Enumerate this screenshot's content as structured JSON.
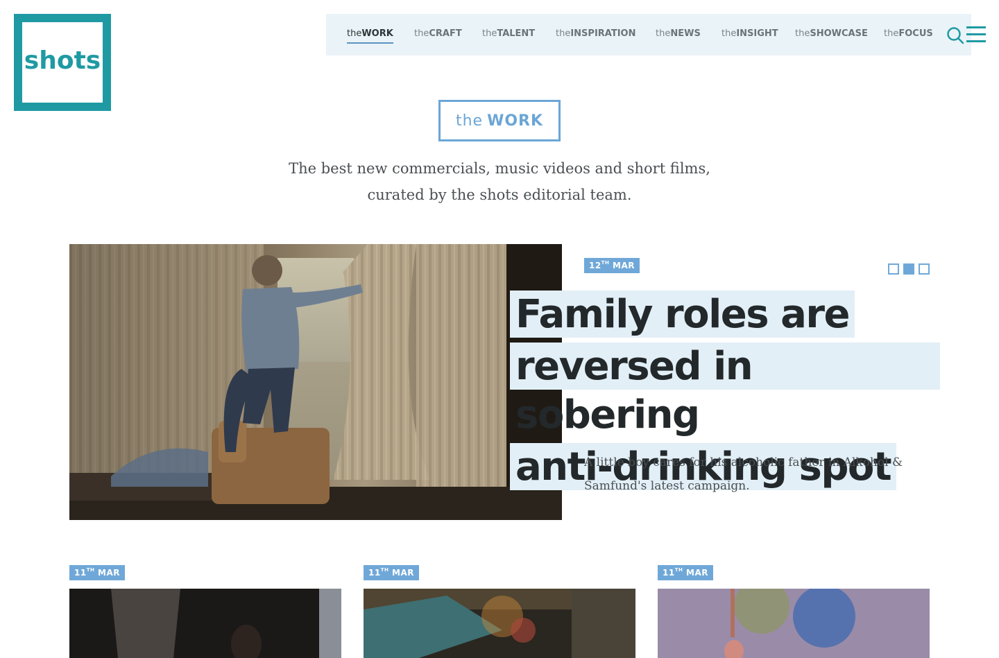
{
  "logo": {
    "text": "shots"
  },
  "nav": {
    "items": [
      {
        "pre": "the",
        "main": "WORK",
        "active": true
      },
      {
        "pre": "the",
        "main": "CRAFT"
      },
      {
        "pre": "the",
        "main": "TALENT"
      },
      {
        "pre": "the",
        "main": "INSPIRATION"
      },
      {
        "pre": "the",
        "main": "NEWS"
      },
      {
        "pre": "the",
        "main": "INSIGHT"
      },
      {
        "pre": "the",
        "main": "SHOWCASE"
      },
      {
        "pre": "the",
        "main": "FOCUS"
      }
    ],
    "icons": [
      "search-icon",
      "menu-icon"
    ]
  },
  "section": {
    "pre": "the",
    "main": "WORK",
    "intro_line1": "The best new commercials, music videos and short films,",
    "intro_line2": "curated by the shots editorial team."
  },
  "hero": {
    "date_day": "12",
    "date_suffix": "TH",
    "date_month": "MAR",
    "headline_lines": [
      "Family roles are",
      "reversed in sobering",
      "anti-drinking spot"
    ],
    "description": "A little boy cares for his alcoholic father in Alkohol & Samfund's latest campaign.",
    "carousel": {
      "count": 3,
      "active_index": 1
    }
  },
  "cards": [
    {
      "date_day": "11",
      "date_suffix": "TH",
      "date_month": "MAR"
    },
    {
      "date_day": "11",
      "date_suffix": "TH",
      "date_month": "MAR"
    },
    {
      "date_day": "11",
      "date_suffix": "TH",
      "date_month": "MAR"
    }
  ],
  "colors": {
    "brand_teal": "#1f9aa3",
    "accent_blue": "#6fa8d8",
    "nav_bg": "#eaf3f7",
    "headline_highlight": "#e2eff6"
  }
}
